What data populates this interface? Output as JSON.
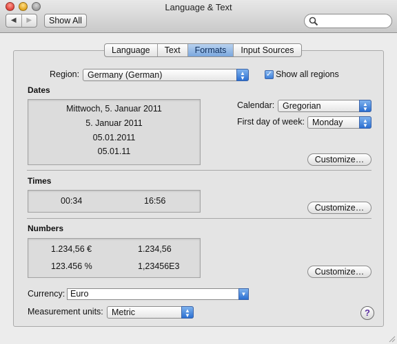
{
  "window": {
    "title": "Language & Text"
  },
  "toolbar": {
    "back_icon": "back-arrow-icon",
    "forward_icon": "forward-arrow-icon",
    "show_all_label": "Show All",
    "search_placeholder": "",
    "search_icon": "magnifier-icon"
  },
  "tabs": [
    {
      "label": "Language",
      "selected": false
    },
    {
      "label": "Text",
      "selected": false
    },
    {
      "label": "Formats",
      "selected": true
    },
    {
      "label": "Input Sources",
      "selected": false
    }
  ],
  "region": {
    "label": "Region:",
    "value": "Germany (German)"
  },
  "show_all_regions": {
    "label": "Show all regions",
    "checked": true
  },
  "dates": {
    "header": "Dates",
    "samples": [
      "Mittwoch, 5. Januar 2011",
      "5. Januar 2011",
      "05.01.2011",
      "05.01.11"
    ],
    "calendar_label": "Calendar:",
    "calendar_value": "Gregorian",
    "first_day_label": "First day of week:",
    "first_day_value": "Monday",
    "customize_label": "Customize…"
  },
  "times": {
    "header": "Times",
    "samples": [
      "00:34",
      "16:56"
    ],
    "customize_label": "Customize…"
  },
  "numbers": {
    "header": "Numbers",
    "samples": [
      "1.234,56 €",
      "1.234,56",
      "123.456 %",
      "1,23456E3"
    ],
    "customize_label": "Customize…"
  },
  "currency": {
    "label": "Currency:",
    "value": "Euro"
  },
  "measurement": {
    "label": "Measurement units:",
    "value": "Metric"
  },
  "help_label": "?",
  "colors": {
    "selected_tab": "#7aa7de",
    "popup_accent": "#2b6fd1",
    "help_glyph": "#5a2fa0"
  }
}
